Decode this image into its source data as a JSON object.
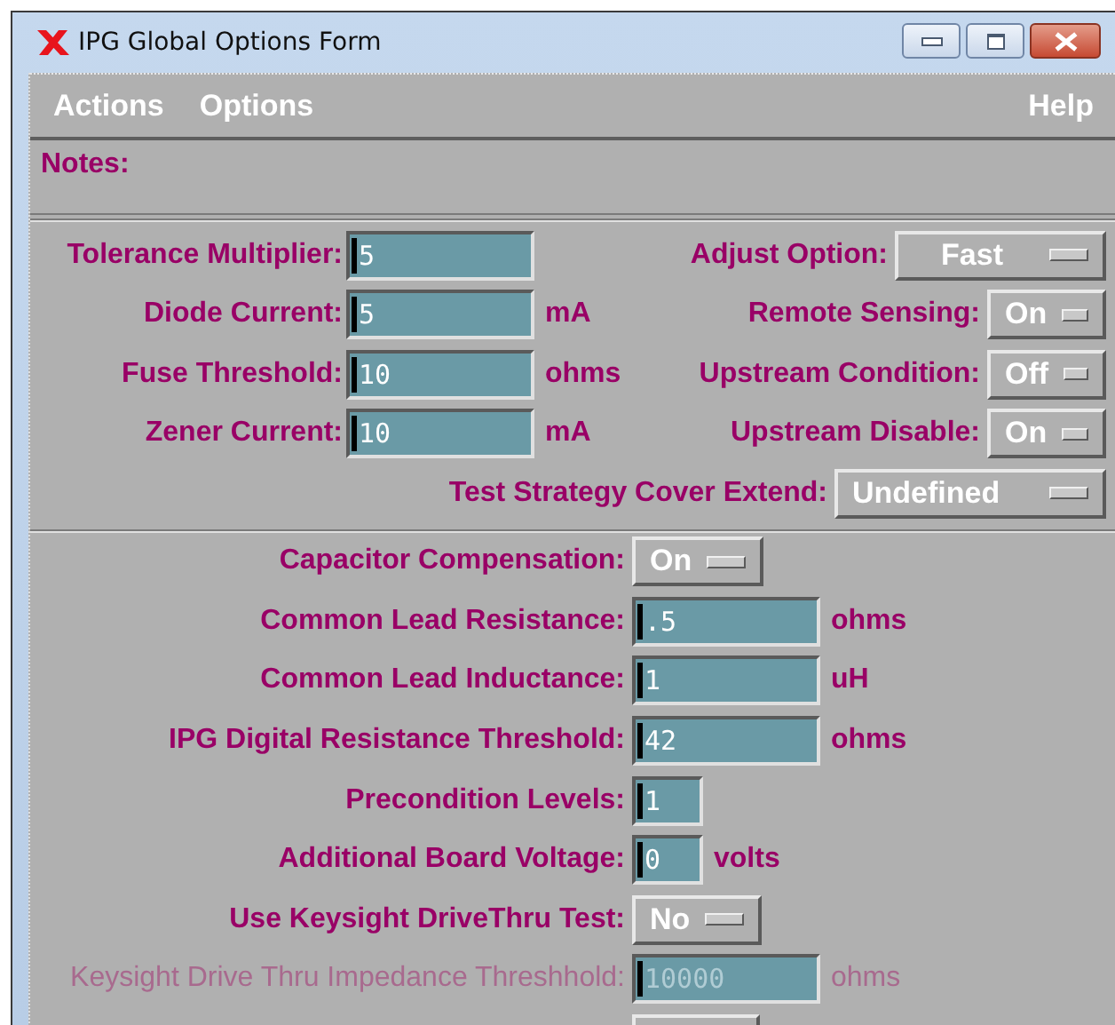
{
  "window": {
    "title": "IPG Global Options Form"
  },
  "menu": [
    {
      "label": "Actions"
    },
    {
      "label": "Options"
    },
    {
      "label": "Help"
    }
  ],
  "notes": {
    "label": "Notes:"
  },
  "section_1": {
    "left": [
      {
        "label": "Tolerance Multiplier:",
        "value": "5"
      },
      {
        "label": "Diode Current:",
        "value": "5",
        "unit": "mA"
      },
      {
        "label": "Fuse Threshold:",
        "value": "10",
        "unit": "ohms"
      },
      {
        "label": "Zener Current:",
        "value": "10",
        "unit": "mA"
      }
    ],
    "right": [
      {
        "label": "Adjust Option:",
        "value": "Fast"
      },
      {
        "label": "Remote Sensing:",
        "value": "On"
      },
      {
        "label": "Upstream Condition:",
        "value": "Off"
      },
      {
        "label": "Upstream Disable:",
        "value": "On"
      }
    ],
    "bottom": {
      "label": "Test Strategy Cover Extend:",
      "value": "Undefined"
    }
  },
  "section_2": [
    {
      "kind": "option",
      "label": "Capacitor Compensation:",
      "value": "On",
      "disabled": false
    },
    {
      "kind": "text",
      "label": "Common Lead Resistance:",
      "value": ".5",
      "unit": "ohms",
      "disabled": false
    },
    {
      "kind": "text",
      "label": "Common Lead Inductance:",
      "value": "1",
      "unit": "uH",
      "disabled": false
    },
    {
      "kind": "text",
      "label": "IPG Digital Resistance Threshold:",
      "value": "42",
      "unit": "ohms",
      "disabled": false
    },
    {
      "kind": "short-text",
      "label": "Precondition Levels:",
      "value": "1",
      "disabled": false
    },
    {
      "kind": "short-text",
      "label": "Additional Board Voltage:",
      "value": "0",
      "unit": "volts",
      "disabled": false
    },
    {
      "kind": "option",
      "label": "Use Keysight DriveThru Test:",
      "value": "No",
      "disabled": false
    },
    {
      "kind": "text",
      "label": "Keysight Drive Thru Impedance Threshhold:",
      "value": "10000",
      "unit": "ohms",
      "disabled": true
    },
    {
      "kind": "cut"
    }
  ]
}
